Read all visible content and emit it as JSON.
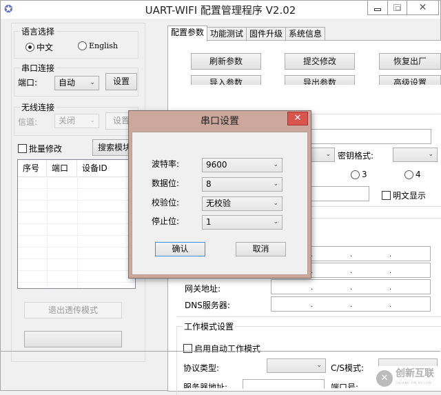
{
  "window": {
    "title": "UART-WIFI 配置管理程序 V2.02",
    "icons": {
      "app": "star-icon",
      "minimize": "minimize-icon",
      "maximize": "maximize-icon",
      "close": "close-icon"
    }
  },
  "left_panel": {
    "language": {
      "legend": "语言选择",
      "options": [
        {
          "label": "中文",
          "selected": true
        },
        {
          "label": "English",
          "selected": false
        }
      ]
    },
    "serial": {
      "legend": "串口连接",
      "port_label": "端口:",
      "port_value": "自动",
      "settings_button": "设置"
    },
    "wireless": {
      "legend": "无线连接",
      "channel_label": "信道:",
      "channel_value": "关闭",
      "settings_button": "设置"
    },
    "batch_modify": {
      "label": "批量修改",
      "checked": false
    },
    "search_button": "搜索模块",
    "device_table": {
      "columns": [
        "序号",
        "端口",
        "设备ID"
      ],
      "rows": []
    },
    "exit_transparent_button": "退出透传模式",
    "blank_button": ""
  },
  "tabs": [
    {
      "label": "配置参数",
      "active": true
    },
    {
      "label": "功能测试",
      "active": false
    },
    {
      "label": "固件升级",
      "active": false
    },
    {
      "label": "系统信息",
      "active": false
    }
  ],
  "config_tab": {
    "buttons": [
      "刷新参数",
      "提交修改",
      "恢复出厂",
      "导入参数",
      "导出参数",
      "高级设置"
    ],
    "key_format_label": "密钥格式:",
    "key_format_value": "",
    "key_index_options": [
      "3",
      "4"
    ],
    "show_plaintext": {
      "label": "明文显示",
      "checked": false
    },
    "gateway_label": "网关地址:",
    "dns_label": "DNS服务器:",
    "ip_separator": ".",
    "work_mode": {
      "legend": "工作模式设置",
      "auto_mode": {
        "label": "启用自动工作模式",
        "checked": false
      },
      "protocol_label": "协议类型:",
      "protocol_value": "",
      "cs_mode_label": "C/S模式:",
      "server_address_label": "服务器地址:",
      "port_label": "端口号:"
    }
  },
  "dialog": {
    "title": "串口设置",
    "close_icon": "close-icon",
    "fields": [
      {
        "label": "波特率:",
        "value": "9600"
      },
      {
        "label": "数据位:",
        "value": "8"
      },
      {
        "label": "校验位:",
        "value": "无校验"
      },
      {
        "label": "停止位:",
        "value": "1"
      }
    ],
    "confirm_button": "确认",
    "cancel_button": "取消"
  },
  "watermark": {
    "text": "创新互联",
    "subtext": "CHUANG XIN HU LIAN"
  }
}
